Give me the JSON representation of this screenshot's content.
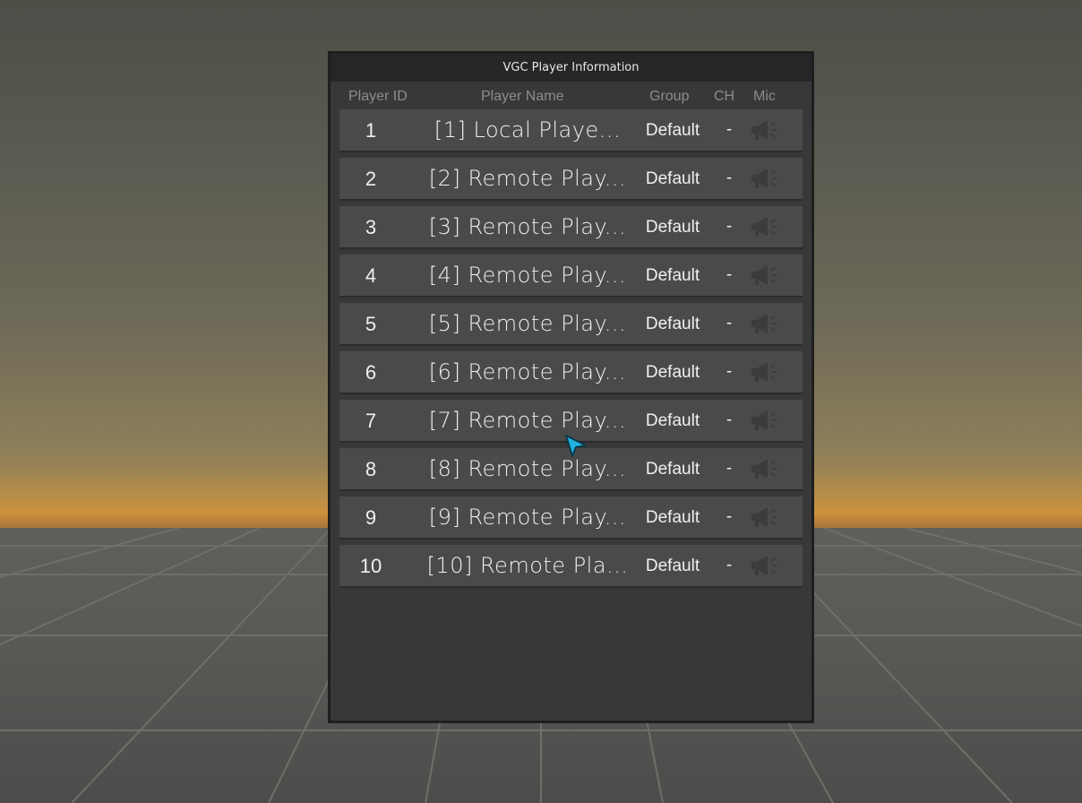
{
  "window": {
    "title": "VGC Player Information"
  },
  "columns": {
    "player_id": "Player ID",
    "player_name": "Player Name",
    "group": "Group",
    "channel": "CH",
    "mic": "Mic"
  },
  "players": [
    {
      "id": "1",
      "name": "[1] Local Playe...",
      "group": "Default",
      "ch": "-",
      "mic_icon": "megaphone-icon"
    },
    {
      "id": "2",
      "name": "[2] Remote Play...",
      "group": "Default",
      "ch": "-",
      "mic_icon": "megaphone-icon"
    },
    {
      "id": "3",
      "name": "[3] Remote Play...",
      "group": "Default",
      "ch": "-",
      "mic_icon": "megaphone-icon"
    },
    {
      "id": "4",
      "name": "[4] Remote Play...",
      "group": "Default",
      "ch": "-",
      "mic_icon": "megaphone-icon"
    },
    {
      "id": "5",
      "name": "[5] Remote Play...",
      "group": "Default",
      "ch": "-",
      "mic_icon": "megaphone-icon"
    },
    {
      "id": "6",
      "name": "[6] Remote Play...",
      "group": "Default",
      "ch": "-",
      "mic_icon": "megaphone-icon"
    },
    {
      "id": "7",
      "name": "[7] Remote Play...",
      "group": "Default",
      "ch": "-",
      "mic_icon": "megaphone-icon"
    },
    {
      "id": "8",
      "name": "[8] Remote Play...",
      "group": "Default",
      "ch": "-",
      "mic_icon": "megaphone-icon"
    },
    {
      "id": "9",
      "name": "[9] Remote Play...",
      "group": "Default",
      "ch": "-",
      "mic_icon": "megaphone-icon"
    },
    {
      "id": "10",
      "name": "[10] Remote Pla...",
      "group": "Default",
      "ch": "-",
      "mic_icon": "megaphone-icon"
    }
  ],
  "colors": {
    "panel": "#383838",
    "row": "#4a4a4a",
    "cursor": "#1fb4e0",
    "horizon": "#c08b3f"
  }
}
